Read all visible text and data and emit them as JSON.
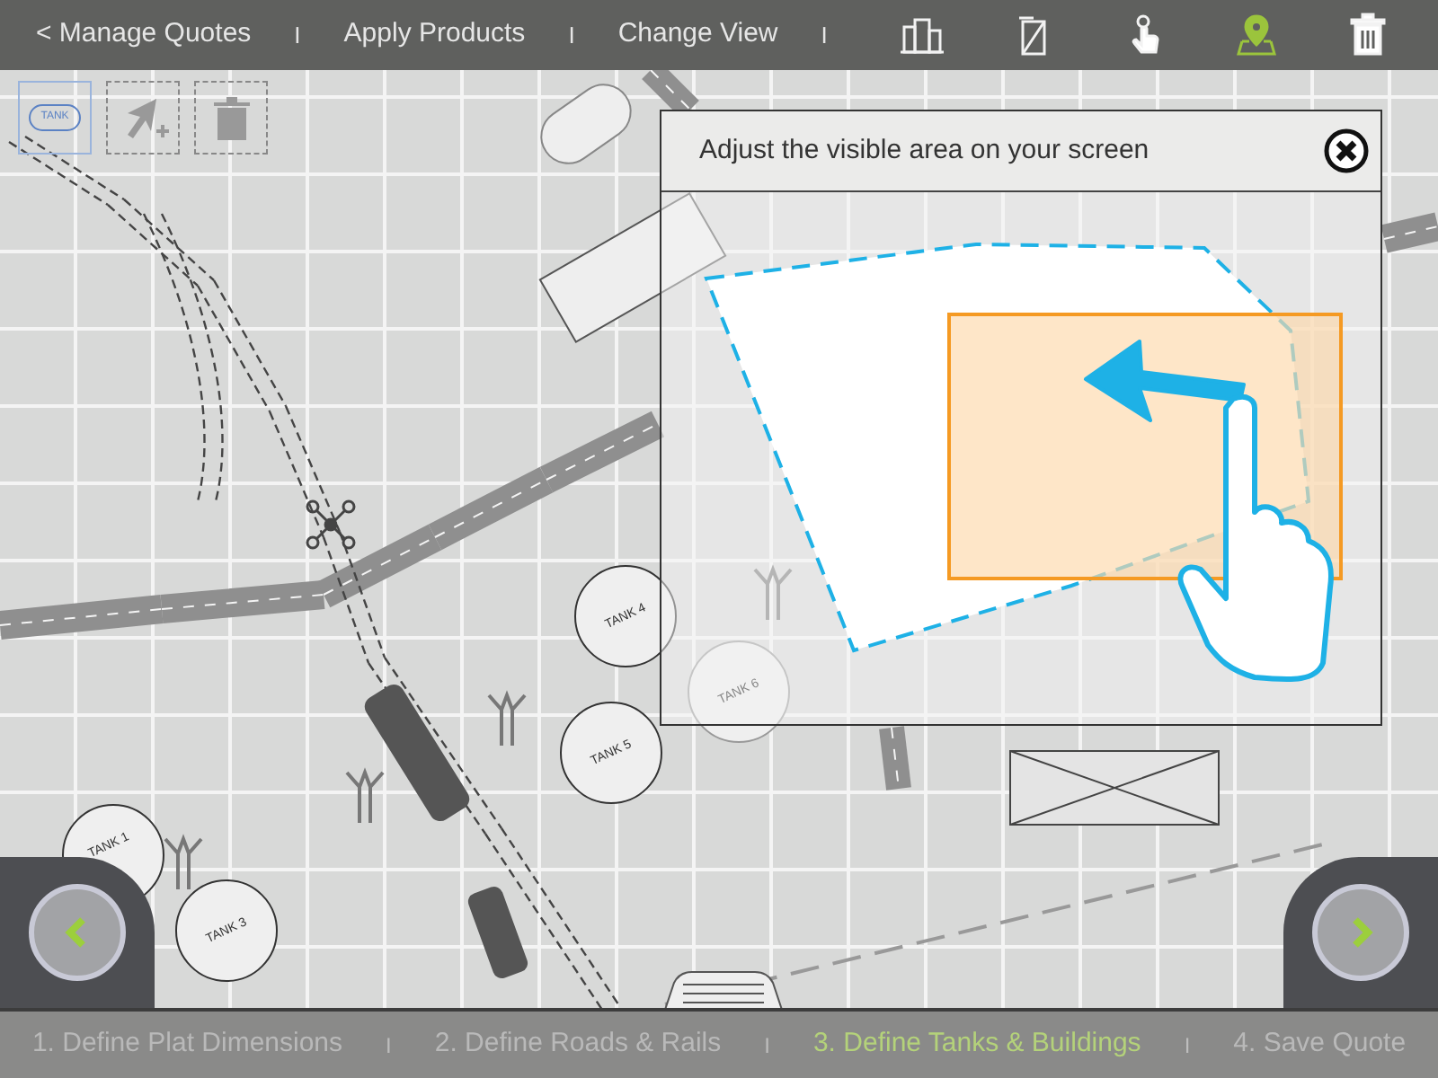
{
  "top_nav": [
    {
      "kind": "link",
      "label": "< Manage Quotes"
    },
    {
      "kind": "divider",
      "label": "I"
    },
    {
      "kind": "link",
      "label": "Apply Products"
    },
    {
      "kind": "divider",
      "label": "I"
    },
    {
      "kind": "link",
      "label": "Change View"
    },
    {
      "kind": "divider",
      "label": "I"
    }
  ],
  "tools": [
    {
      "kind": "buildings",
      "selected": false
    },
    {
      "kind": "ruler",
      "selected": false
    },
    {
      "kind": "hand",
      "selected": false
    },
    {
      "kind": "pin",
      "selected": true
    },
    {
      "kind": "trash",
      "selected": false
    }
  ],
  "palette": [
    {
      "kind": "tank",
      "label": "TANK",
      "selected": true
    },
    {
      "kind": "add-pointer",
      "selected": false
    },
    {
      "kind": "trash",
      "selected": false
    }
  ],
  "map": {
    "tanks": [
      {
        "label": "TANK 4",
        "faded": false
      },
      {
        "label": "TANK 6",
        "faded": true
      },
      {
        "label": "TANK 5",
        "faded": false
      },
      {
        "label": "TANK 1",
        "faded": false
      },
      {
        "label": "TANK 3",
        "faded": false
      }
    ]
  },
  "dialog": {
    "title": "Adjust the visible area on your screen"
  },
  "steps": [
    {
      "kind": "step",
      "label": "1. Define Plat Dimensions",
      "selected": false
    },
    {
      "kind": "divider",
      "label": "I"
    },
    {
      "kind": "step",
      "label": "2. Define Roads & Rails",
      "selected": false
    },
    {
      "kind": "divider",
      "label": "I"
    },
    {
      "kind": "step",
      "label": "3. Define Tanks & Buildings",
      "selected": true
    },
    {
      "kind": "divider",
      "label": "I"
    },
    {
      "kind": "step",
      "label": "4. Save Quote",
      "selected": false
    }
  ]
}
